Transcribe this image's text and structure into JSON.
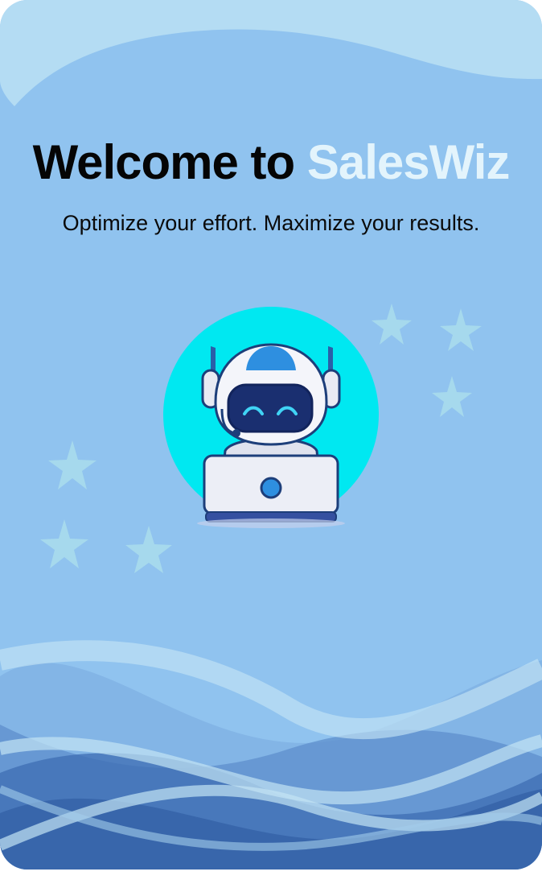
{
  "welcome": {
    "title_prefix": "Welcome to ",
    "brand_name": "SalesWiz",
    "tagline": "Optimize your effort. Maximize your results."
  },
  "illustration": {
    "icon": "robot-laptop-icon",
    "decorations": "sparkle-star-icon"
  },
  "colors": {
    "background": "#90c3ef",
    "brand_text": "#e3f4fc",
    "title_text": "#050505",
    "mascot_circle": "#00e6f0",
    "wave_dark": "#3d6fb0",
    "wave_light": "#c3e4f4"
  }
}
